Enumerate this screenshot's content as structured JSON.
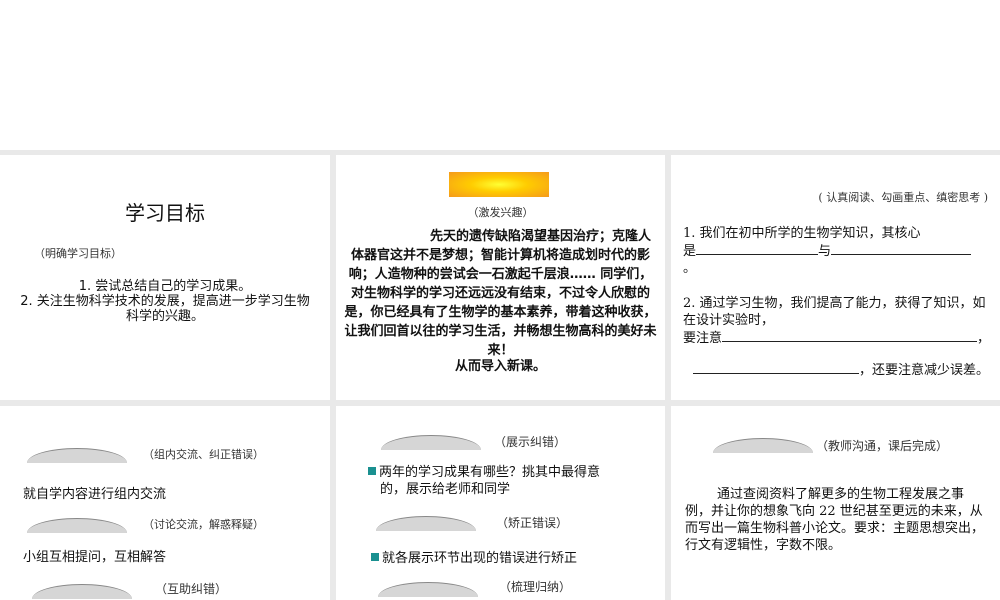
{
  "slides": {
    "s1": {
      "title": "学习目标",
      "note": "（明确学习目标）",
      "items": [
        "1. 尝试总结自己的学习成果。",
        "2. 关注生物科学技术的发展，提高进一步学习生物科学的兴趣。"
      ]
    },
    "s2": {
      "note": "（激发兴趣）",
      "body": "先天的遗传缺陷渴望基因治疗；克隆人体器官这并不是梦想；智能计算机将造成划时代的影响；人造物种的尝试会一石激起千层浪…… 同学们，对生物科学的学习还远远没有结束，不过令人欣慰的是，你已经具有了生物学的基本素养，带着这种收获，让我们回首以往的学习生活，并畅想生物高科的美好未来！",
      "closing": "从而导入新课。"
    },
    "s3": {
      "note": "( 认真阅读、勾画重点、缜密思考 )",
      "q1_a": "1. 我们在初中所学的生物学知识，其核心",
      "q1_b": "是",
      "q1_c": "与",
      "q1_d": "。",
      "q2_a": "2. 通过学习生物，我们提高了能力，获得了知识，如在设计实验时，",
      "q2_b": "要注意",
      "q2_c": "，",
      "q2_d": "，还要注意减少误差。"
    },
    "s4": {
      "note1": "（组内交流、纠正错误）",
      "text1": "就自学内容进行组内交流",
      "note2": "（讨论交流，解惑释疑）",
      "text2": "小组互相提问，互相解答",
      "note3": "（互助纠错）"
    },
    "s5": {
      "note1": "（展示纠错）",
      "text1": "两年的学习成果有哪些？挑其中最得意的，展示给老师和同学",
      "note2": "（矫正错误）",
      "text2": "就各展示环节出现的错误进行矫正",
      "note3": "（梳理归纳）"
    },
    "s6": {
      "note": "（教师沟通，课后完成）",
      "body": "通过查阅资料了解更多的生物工程发展之事例，并让你的想象飞向 22 世纪甚至更远的未来，从而写出一篇生物科普小论文。要求：主题思想突出，行文有逻辑性，字数不限。"
    }
  },
  "colors": {
    "bullet": "#1a9090",
    "banner": "#ffcc00"
  }
}
